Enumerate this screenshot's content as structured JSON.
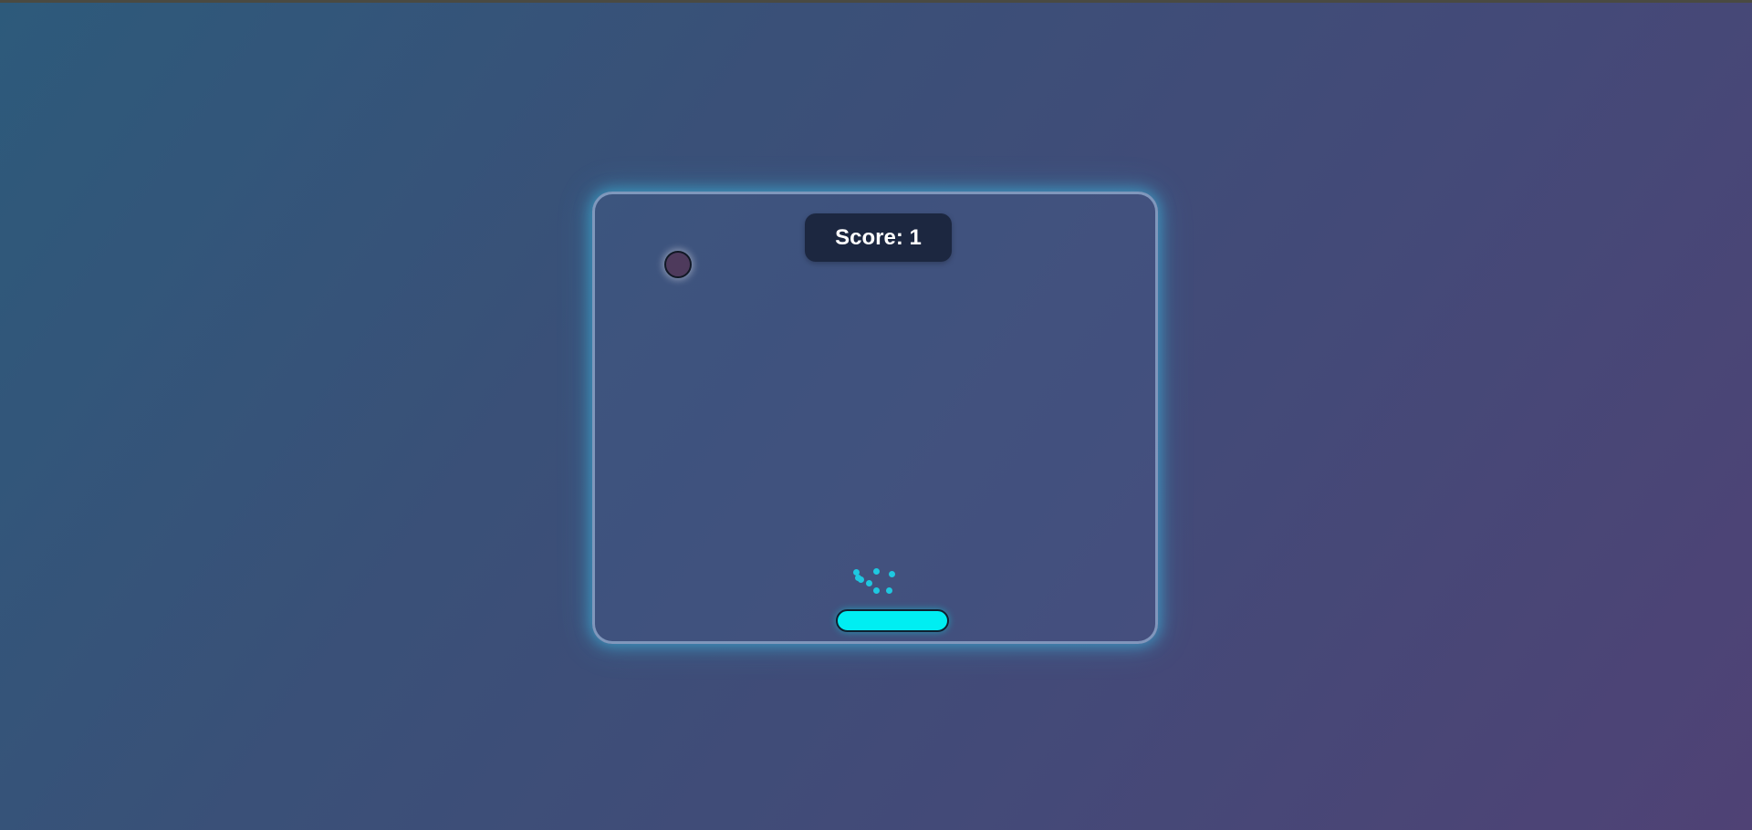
{
  "hud": {
    "score_label": "Score: 1"
  },
  "colors": {
    "background_start": "#2d5a7b",
    "background_end": "#4f4275",
    "board_glow": "#3cc8f0",
    "score_badge_bg": "#1c2740",
    "ball_fill": "#4e3a5c",
    "paddle_fill": "#00eef2",
    "particle_fill": "#1ec8e0"
  }
}
